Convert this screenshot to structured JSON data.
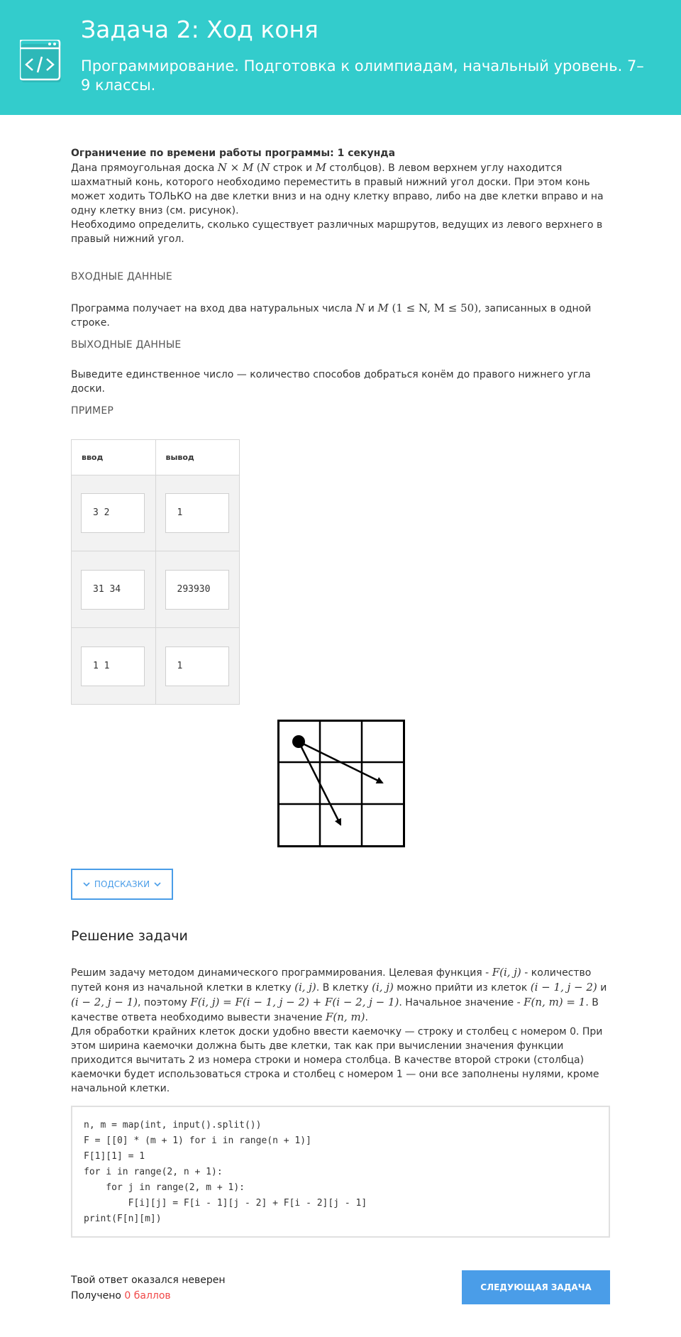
{
  "header": {
    "title": "Задача 2: Ход коня",
    "subtitle": "Программирование. Подготовка к олимпиадам, начальный уровень. 7–9 классы.",
    "icon": "code-window-icon",
    "accent_color": "#33cccc"
  },
  "statement": {
    "time_limit": "Ограничение по времени работы программы: 1 секунда",
    "p1_a": "Дана прямоугольная доска ",
    "p1_math1_a": "N",
    "p1_math1_op": " × ",
    "p1_math1_b": "M",
    "p1_b": " (",
    "p1_math2": "N",
    "p1_c": " строк и ",
    "p1_math3": "M",
    "p1_d": " столбцов). В левом верхнем углу находится шахматный конь, которого необходимо переместить в правый нижний угол доски. При этом конь может ходить ТОЛЬКО на две клетки вниз и на одну клетку вправо, либо на две клетки вправо и на одну клетку вниз (см. рисунок).",
    "p2": "Необходимо определить, сколько существует различных маршрутов, ведущих из левого верхнего в правый нижний угол."
  },
  "input_section": {
    "label": "Входные данные",
    "text_a": "Программа получает на вход два натуральных числа ",
    "math_n": "N",
    "text_b": " и ",
    "math_m": "M",
    "math_constraint": " (1 ≤ N, M ≤ 50)",
    "text_c": ", записанных в одной строке."
  },
  "output_section": {
    "label": "Выходные данные",
    "text": "Выведите единственное число — количество способов добраться конём до правого нижнего угла доски."
  },
  "example": {
    "label": "Пример",
    "columns": [
      "ввод",
      "вывод"
    ],
    "rows": [
      {
        "input": "3 2",
        "output": "1"
      },
      {
        "input": "31 34",
        "output": "293930"
      },
      {
        "input": "1 1",
        "output": "1"
      }
    ]
  },
  "figure": {
    "type": "knight-moves-board",
    "rows": 3,
    "cols": 3
  },
  "hints_button": {
    "label": "Подсказки",
    "color": "#4a9de8"
  },
  "solution": {
    "title": "Решение задачи",
    "p1_a": "Решим задачу методом динамического программирования. Целевая функция - ",
    "p1_m1": "F(i, j)",
    "p1_b": " - количество путей коня из начальной клетки в клетку ",
    "p1_m2": "(i, j)",
    "p1_c": ". В клетку ",
    "p1_m3": "(i, j)",
    "p1_d": " можно прийти из клеток ",
    "p1_m4": "(i − 1, j − 2)",
    "p1_e": " и ",
    "p1_m5": "(i − 2, j − 1)",
    "p1_f": ", поэтому ",
    "p1_m6": "F(i, j) = F(i − 1, j − 2) + F(i − 2, j − 1)",
    "p1_g": ". Начальное значение - ",
    "p1_m7": "F(n, m) = 1",
    "p1_h": ". В качестве ответа необходимо вывести значение ",
    "p1_m8": "F(n, m)",
    "p1_i": ".",
    "p2": "Для обработки крайних клеток доски удобно ввести каемочку — строку и столбец с номером 0. При этом ширина каемочки должна быть две клетки, так как при вычислении значения функции приходится вычитать 2 из номера строки и номера столбца. В качестве второй строки (столбца) каемочки будет использоваться строка и столбец с номером 1 — они все заполнены нулями, кроме начальной клетки.",
    "code": [
      "n, m = map(int, input().split())",
      "F = [[0] * (m + 1) for i in range(n + 1)]",
      "F[1][1] = 1",
      "for i in range(2, n + 1):",
      "    for j in range(2, m + 1):",
      "        F[i][j] = F[i - 1][j - 2] + F[i - 2][j - 1]",
      "print(F[n][m])"
    ]
  },
  "result": {
    "verdict": "Твой ответ оказался неверен",
    "score_prefix": "Получено ",
    "score": "0 баллов",
    "score_color": "#f04646"
  },
  "next_button": {
    "label": "Следующая задача"
  }
}
